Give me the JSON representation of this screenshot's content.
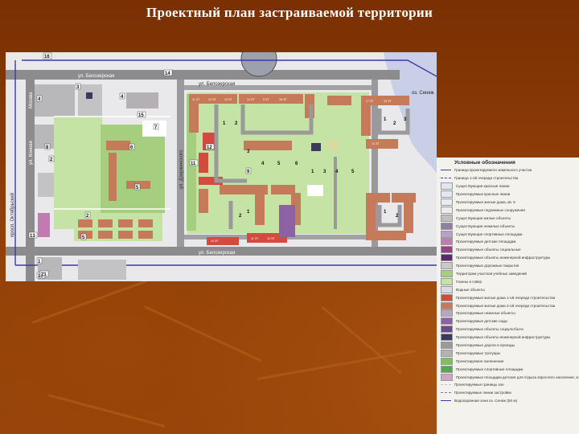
{
  "title": "Проектный план застраиваемой территории",
  "map": {
    "streets": {
      "top_left": "ул. Белозерская",
      "top_mid": "ул. Белозерская",
      "bottom": "ул. Белозерская",
      "left_a": "Москва",
      "left_b": "ул. Конная",
      "left_c": "просп. Октябрьский",
      "top_right": "ул. Дзержинского"
    },
    "water_label": "оз. Сенеж",
    "block_labels": [
      "16",
      "14",
      "3",
      "4",
      "15",
      "7",
      "2",
      "8",
      "6",
      "5",
      "2",
      "13",
      "1",
      "10",
      "5",
      "21",
      "11",
      "12",
      "9",
      "4"
    ],
    "house_labels": [
      "1",
      "2",
      "3",
      "4",
      "5",
      "6",
      "1",
      "2",
      "3",
      "1",
      "2",
      "1",
      "3",
      "4",
      "5",
      "1",
      "2"
    ],
    "building_codes": [
      "11 ЭТ",
      "12 ЭТ",
      "10 ЭТ",
      "14 ЭТ",
      "9 ЭТ",
      "16 ЭТ",
      "17 ЭТ",
      "15 ЭТ",
      "13 ЭТ",
      "10 ЭТ",
      "11 ЭТ",
      "12 ЭТ"
    ]
  },
  "legend": {
    "title": "Условные обозначения",
    "items": [
      {
        "label": "Граница проектируемого земельного участка",
        "color": "#3a3aa8",
        "kind": "line"
      },
      {
        "label": "Граница 1-ой очереди строительства",
        "color": "#3a3aa8",
        "kind": "dash"
      },
      {
        "label": "Существующие красные линии",
        "color": "#dfe6f4",
        "kind": "box"
      },
      {
        "label": "Проектируемые красные линии",
        "color": "#e2e7f2",
        "kind": "box"
      },
      {
        "label": "Проектируемые жилые дома, кв. 5",
        "color": "#e6ebf5",
        "kind": "box"
      },
      {
        "label": "Проектируемые подземные сооружения",
        "color": "#ececef",
        "kind": "box"
      },
      {
        "label": "Существующие жилые объекты",
        "color": "#bfbfbf",
        "kind": "box"
      },
      {
        "label": "Существующие нежилые объекты",
        "color": "#8e7fa3",
        "kind": "box"
      },
      {
        "label": "Существующие спортивные площадки",
        "color": "#b9a0c9",
        "kind": "box"
      },
      {
        "label": "Проектируемые детские площадки",
        "color": "#c07bb1",
        "kind": "box"
      },
      {
        "label": "Проектируемые объекты социальные",
        "color": "#9b3f87",
        "kind": "box"
      },
      {
        "label": "Проектируемые объекты инженерной инфраструктуры",
        "color": "#5b2a6a",
        "kind": "box"
      },
      {
        "label": "Проектируемые дорожные покрытия",
        "color": "#c9c7c9",
        "kind": "box"
      },
      {
        "label": "Территории участков учебных заведений",
        "color": "#a6ce7f",
        "kind": "box"
      },
      {
        "label": "Газоны и сквер",
        "color": "#c5e3a4",
        "kind": "box"
      },
      {
        "label": "Водные объекты",
        "color": "#d9d9e8",
        "kind": "box"
      },
      {
        "label": "Проектируемые жилые дома 1-ой очереди строительства",
        "color": "#d44a3e",
        "kind": "box"
      },
      {
        "label": "Проектируемые жилые дома 2-ой очереди строительства",
        "color": "#c57a5a",
        "kind": "box"
      },
      {
        "label": "Проектируемые нежилые объекты",
        "color": "#b8a5c2",
        "kind": "box"
      },
      {
        "label": "Проектируемые детские сады",
        "color": "#8c62a5",
        "kind": "box"
      },
      {
        "label": "Проектируемые объекты соцкультбыта",
        "color": "#6a4b8f",
        "kind": "box"
      },
      {
        "label": "Проектируемые объекты инженерной инфраструктуры",
        "color": "#3b3a5a",
        "kind": "box"
      },
      {
        "label": "Проектируемые дороги и проезды",
        "color": "#9a9a9a",
        "kind": "box"
      },
      {
        "label": "Проектируемые тротуары",
        "color": "#b4b0b4",
        "kind": "box"
      },
      {
        "label": "Проектируемое озеленение",
        "color": "#7fbf5f",
        "kind": "box"
      },
      {
        "label": "Проектируемые спортивные площадки",
        "color": "#57a650",
        "kind": "box"
      },
      {
        "label": "Проектируемые площадки детские для отдыха взрослого населения, хозяйственные",
        "color": "#d3a4c9",
        "kind": "box"
      },
      {
        "label": "Проектируемые границы зон",
        "color": "#c0c0d8",
        "kind": "dash"
      },
      {
        "label": "Проектируемые линии застройки",
        "color": "#7777aa",
        "kind": "dash"
      },
      {
        "label": "Водоохранная зона оз. Сенеж (50 м)",
        "color": "#3a3aa8",
        "kind": "line"
      }
    ]
  }
}
